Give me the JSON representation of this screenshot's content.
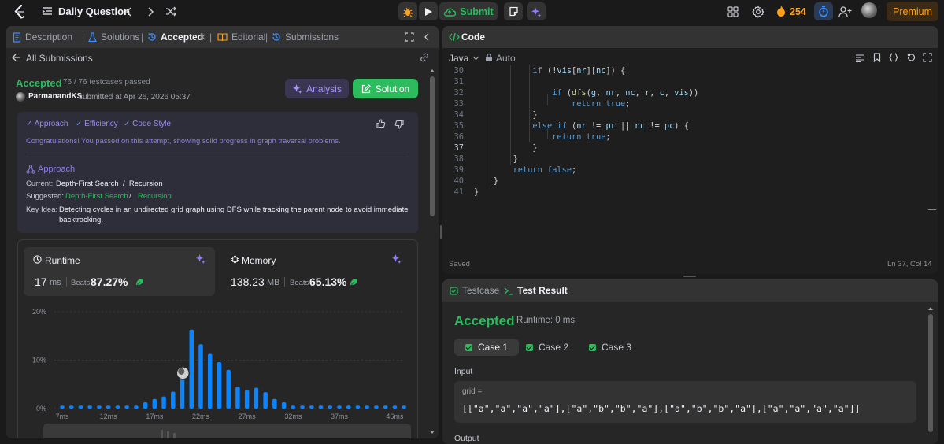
{
  "topbar": {
    "title": "Daily Question",
    "submit_label": "Submit",
    "streak_count": "254",
    "premium_label": "Premium"
  },
  "left_tabs": [
    {
      "label": "Description"
    },
    {
      "label": "Solutions"
    },
    {
      "label": "Accepted"
    },
    {
      "label": "Editorial"
    },
    {
      "label": "Submissions"
    }
  ],
  "nav": {
    "back_label": "All Submissions"
  },
  "result": {
    "status": "Accepted",
    "testcases": "76 / 76 testcases passed",
    "user": "ParmanandKS",
    "submitted": "submitted at Apr 26, 2026 05:37",
    "analysis_label": "Analysis",
    "solution_label": "Solution"
  },
  "feedback": {
    "chips": [
      "Approach",
      "Efficiency",
      "Code Style"
    ],
    "message": "Congratulations! You passed on this attempt, showing solid progress in graph traversal problems.",
    "approach_title": "Approach",
    "current_label": "Current:",
    "current_value": "Depth-First Search  /  Recursion",
    "suggested_label": "Suggested:",
    "suggested_a": "Depth-First Search",
    "suggested_sep": "/",
    "suggested_b": "Recursion",
    "key_idea_label": "Key Idea:",
    "key_idea_line1": "Detecting cycles in an undirected grid graph using DFS while tracking the parent node to avoid immediate",
    "key_idea_line2": "backtracking."
  },
  "stats": {
    "runtime_title": "Runtime",
    "runtime_value": "17",
    "runtime_unit": "ms",
    "runtime_beats_label": "Beats",
    "runtime_beats": "87.27%",
    "memory_title": "Memory",
    "memory_value": "138.23",
    "memory_unit": "MB",
    "memory_beats_label": "Beats",
    "memory_beats": "65.13%"
  },
  "chart_data": {
    "type": "bar",
    "ylim": [
      0,
      20
    ],
    "yticks": [
      "20%",
      "10%",
      "0%"
    ],
    "xticks": [
      "7ms",
      "12ms",
      "17ms",
      "22ms",
      "27ms",
      "32ms",
      "37ms",
      "46ms"
    ],
    "values": [
      0.6,
      0.6,
      0.6,
      0.6,
      0.6,
      0.6,
      0.6,
      0.6,
      0.6,
      1.3,
      2.0,
      2.5,
      3.5,
      6.6,
      16.3,
      13.3,
      11.3,
      9.6,
      8.0,
      4.5,
      3.8,
      4.3,
      3.4,
      2.0,
      1.3,
      0.6,
      0.6,
      0.6,
      0.6,
      0.6,
      0.6,
      0.6,
      0.6,
      0.6,
      0.6,
      0.6,
      0.6,
      0.6
    ],
    "marker_index": 14,
    "bar_color": "#0a84ff"
  },
  "code": {
    "title": "Code",
    "language": "Java",
    "mode": "Auto",
    "saved": "Saved",
    "cursor": "Ln 37, Col 14",
    "line_numbers": [
      "30",
      "31",
      "32",
      "33",
      "34",
      "35",
      "36",
      "37",
      "38",
      "39",
      "40",
      "41"
    ],
    "lines": [
      "            if (!vis[nr][nc]) {",
      "",
      "                if (dfs(g, nr, nc, r, c, vis))",
      "                    return true;",
      "            }",
      "            else if (nr != pr || nc != pc) {",
      "                return true;",
      "            }",
      "        }",
      "        return false;",
      "    }",
      "}"
    ]
  },
  "testpanel": {
    "tab_testcase": "Testcase",
    "tab_result": "Test Result",
    "status": "Accepted",
    "runtime": "Runtime: 0 ms",
    "cases": [
      "Case 1",
      "Case 2",
      "Case 3"
    ],
    "input_label": "Input",
    "param_name": "grid =",
    "param_value": "[[\"a\",\"a\",\"a\",\"a\"],[\"a\",\"b\",\"b\",\"a\"],[\"a\",\"b\",\"b\",\"a\"],[\"a\",\"a\",\"a\",\"a\"]]",
    "output_label": "Output"
  }
}
